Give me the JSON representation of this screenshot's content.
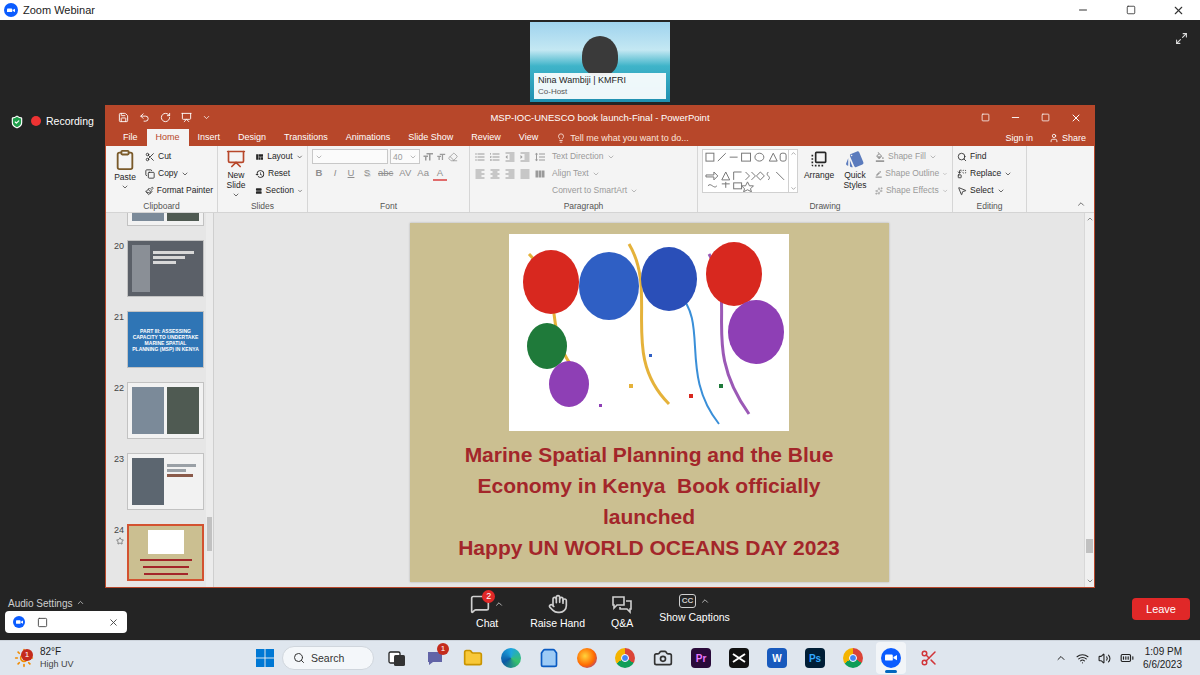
{
  "zoom": {
    "title": "Zoom Webinar",
    "recording": "Recording",
    "video": {
      "name": "Nina Wambiji | KMFRI",
      "role": "Co-Host"
    }
  },
  "powerpoint": {
    "title": "MSP-IOC-UNESCO book launch-Final - PowerPoint",
    "tabs": [
      {
        "label": "File",
        "selected": false
      },
      {
        "label": "Home",
        "selected": true
      },
      {
        "label": "Insert",
        "selected": false
      },
      {
        "label": "Design",
        "selected": false
      },
      {
        "label": "Transitions",
        "selected": false
      },
      {
        "label": "Animations",
        "selected": false
      },
      {
        "label": "Slide Show",
        "selected": false
      },
      {
        "label": "Review",
        "selected": false
      },
      {
        "label": "View",
        "selected": false
      }
    ],
    "tell_me": "Tell me what you want to do...",
    "sign_in": "Sign in",
    "share": "Share",
    "ribbon": {
      "clipboard": {
        "label": "Clipboard",
        "paste": "Paste",
        "items": [
          {
            "label": "Cut",
            "disabled": false,
            "menu": false
          },
          {
            "label": "Copy",
            "disabled": false,
            "menu": true
          },
          {
            "label": "Format Painter",
            "disabled": false,
            "menu": false
          }
        ]
      },
      "slides": {
        "label": "Slides",
        "new_slide": "New Slide",
        "items": [
          {
            "label": "Layout",
            "disabled": false,
            "menu": true
          },
          {
            "label": "Reset",
            "disabled": false,
            "menu": false
          },
          {
            "label": "Section",
            "disabled": false,
            "menu": true
          }
        ]
      },
      "font": {
        "label": "Font",
        "name": "",
        "size": "40",
        "disabled": true,
        "buttons": [
          {
            "label": "B",
            "kind": "bold"
          },
          {
            "label": "I",
            "kind": "italic"
          },
          {
            "label": "U",
            "kind": "underline"
          },
          {
            "label": "S",
            "kind": "shadow"
          },
          {
            "label": "abc",
            "kind": "strike"
          },
          {
            "label": "AV",
            "kind": "spacing"
          },
          {
            "label": "Aa",
            "kind": "case"
          },
          {
            "label": "A",
            "kind": "color"
          }
        ]
      },
      "paragraph": {
        "label": "Paragraph",
        "items": [
          {
            "label": "Text Direction",
            "disabled": true,
            "menu": true
          },
          {
            "label": "Align Text",
            "disabled": true,
            "menu": true
          },
          {
            "label": "Convert to SmartArt",
            "disabled": true,
            "menu": true
          }
        ]
      },
      "drawing": {
        "label": "Drawing",
        "arrange": "Arrange",
        "quick_styles": "Quick Styles",
        "items": [
          {
            "label": "Shape Fill",
            "disabled": true,
            "menu": true
          },
          {
            "label": "Shape Outline",
            "disabled": true,
            "menu": true
          },
          {
            "label": "Shape Effects",
            "disabled": true,
            "menu": true
          }
        ]
      },
      "editing": {
        "label": "Editing",
        "items": [
          {
            "label": "Find",
            "disabled": false,
            "menu": false
          },
          {
            "label": "Replace",
            "disabled": false,
            "menu": true
          },
          {
            "label": "Select",
            "disabled": false,
            "menu": true
          }
        ]
      }
    },
    "slides": [
      {
        "number": "",
        "kind": "photo",
        "selected": false,
        "transition": false,
        "title": ""
      },
      {
        "number": "20",
        "kind": "text",
        "selected": false,
        "transition": false,
        "title": ""
      },
      {
        "number": "21",
        "kind": "section",
        "selected": false,
        "transition": false,
        "title": "PART III: ASSESSING CAPACITY TO UNDERTAKE MARINE SPATIAL PLANNING (MSP) IN KENYA"
      },
      {
        "number": "22",
        "kind": "photo",
        "selected": false,
        "transition": false,
        "title": ""
      },
      {
        "number": "23",
        "kind": "photo-text",
        "selected": false,
        "transition": false,
        "title": ""
      },
      {
        "number": "24",
        "kind": "celebration",
        "selected": true,
        "transition": true,
        "title": ""
      }
    ],
    "slide": {
      "title": "Marine Spatial Planning and the Blue Economy in Kenya  Book officially launched",
      "subtitle": "Happy UN WORLD OCEANS DAY 2023"
    }
  },
  "toolbar": {
    "audio": "Audio Settings",
    "items": [
      {
        "kind": "chat",
        "label": "Chat",
        "badge": "2",
        "glyph": "",
        "menu": true
      },
      {
        "kind": "hand",
        "label": "Raise Hand",
        "badge": "",
        "glyph": "",
        "menu": false
      },
      {
        "kind": "qa",
        "label": "Q&A",
        "badge": "",
        "glyph": "",
        "menu": false
      },
      {
        "kind": "captions",
        "label": "Show Captions",
        "badge": "",
        "glyph": "CC",
        "menu": true
      }
    ],
    "leave": "Leave"
  },
  "taskbar": {
    "weather": {
      "temp": "82°F",
      "condition": "High UV",
      "badge": "1"
    },
    "search": "Search",
    "apps": [
      {
        "kind": "taskview",
        "glyph": "",
        "badge": "",
        "active": false
      },
      {
        "kind": "teams",
        "glyph": "",
        "badge": "1",
        "active": false
      },
      {
        "kind": "explorer",
        "glyph": "",
        "badge": "",
        "active": false
      },
      {
        "kind": "edge",
        "glyph": "",
        "badge": "",
        "active": false
      },
      {
        "kind": "store",
        "glyph": "",
        "badge": "",
        "active": false
      },
      {
        "kind": "firefox",
        "glyph": "",
        "badge": "",
        "active": false
      },
      {
        "kind": "chrome",
        "glyph": "",
        "badge": "",
        "active": false
      },
      {
        "kind": "camera",
        "glyph": "",
        "badge": "",
        "active": false
      },
      {
        "kind": "premiere",
        "glyph": "Pr",
        "badge": "",
        "active": false
      },
      {
        "kind": "capcut",
        "glyph": "",
        "badge": "",
        "active": false
      },
      {
        "kind": "word",
        "glyph": "W",
        "badge": "",
        "active": false
      },
      {
        "kind": "photoshop",
        "glyph": "Ps",
        "badge": "",
        "active": false
      },
      {
        "kind": "chrome-profile",
        "glyph": "",
        "badge": "",
        "active": false
      },
      {
        "kind": "zoom",
        "glyph": "",
        "badge": "",
        "active": true
      },
      {
        "kind": "snip",
        "glyph": "",
        "badge": "",
        "active": false
      }
    ],
    "clock": {
      "time": "1:09 PM",
      "date": "6/6/2023"
    }
  }
}
